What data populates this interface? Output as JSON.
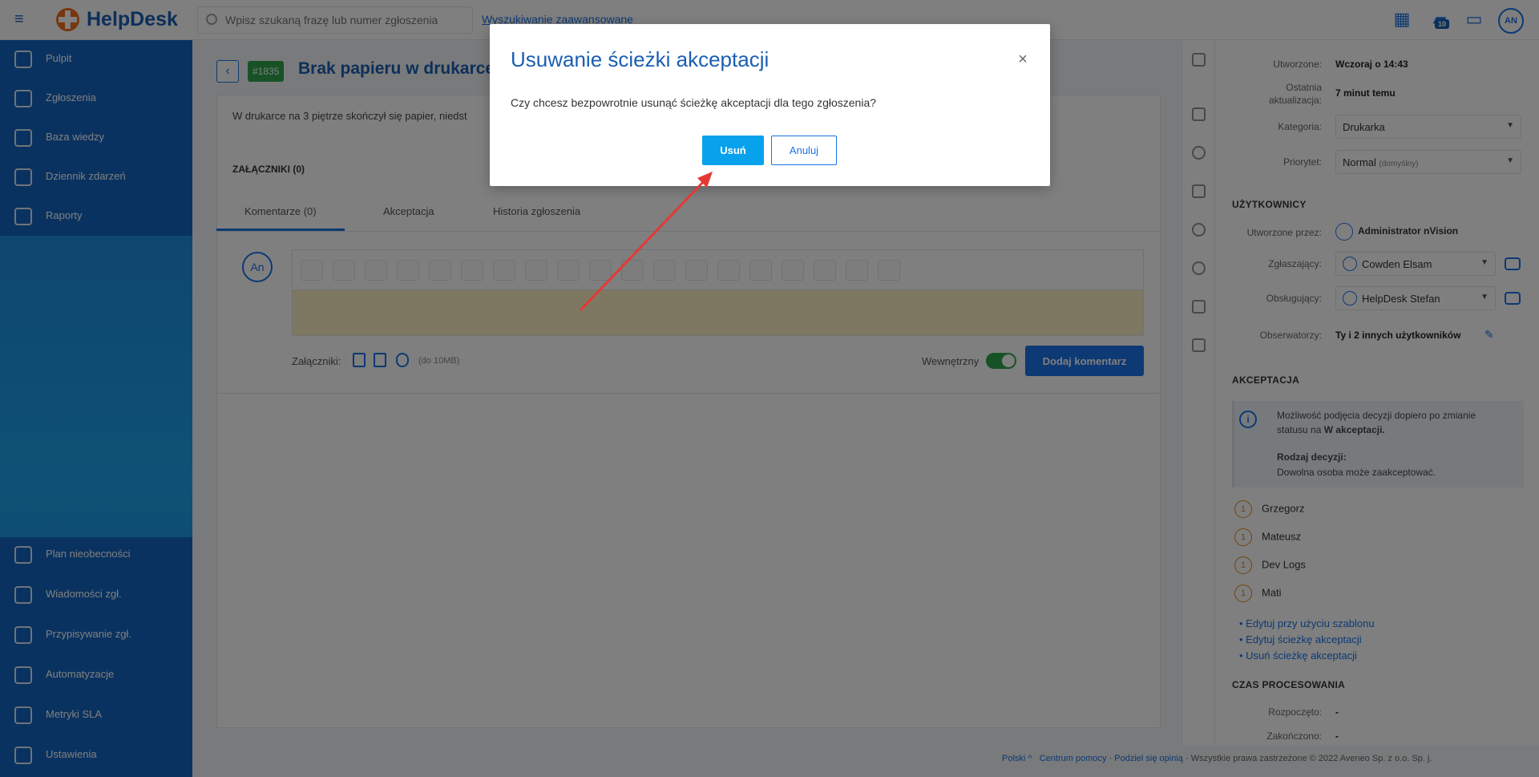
{
  "app": {
    "logo": "HelpDesk"
  },
  "topbar": {
    "search_placeholder": "Wpisz szukaną frazę lub numer zgłoszenia",
    "advanced_search": "Wyszukiwanie zaawansowane",
    "notif_count": "10",
    "user_initials": "AN"
  },
  "sidebar": {
    "items": [
      {
        "label": "Pulpit",
        "icon": "dashboard-icon"
      },
      {
        "label": "Zgłoszenia",
        "icon": "tickets-icon"
      },
      {
        "label": "Baza wiedzy",
        "icon": "knowledge-base-icon"
      },
      {
        "label": "Dziennik zdarzeń",
        "icon": "event-log-icon"
      },
      {
        "label": "Raporty",
        "icon": "reports-icon"
      }
    ],
    "bottom_items": [
      {
        "label": "Plan nieobecności",
        "icon": "absence-plan-icon"
      },
      {
        "label": "Wiadomości zgł.",
        "icon": "messages-icon"
      },
      {
        "label": "Przypisywanie zgł.",
        "icon": "assign-icon"
      },
      {
        "label": "Automatyzacje",
        "icon": "automation-icon"
      },
      {
        "label": "Metryki SLA",
        "icon": "sla-icon"
      },
      {
        "label": "Ustawienia",
        "icon": "settings-icon"
      }
    ]
  },
  "ticket": {
    "id": "#1835",
    "title": "Brak papieru w drukarce",
    "description": "W drukarce na 3 piętrze skończył się papier, niedst",
    "attachments_header": "ZAŁĄCZNIKI (0)",
    "tabs": [
      "Komentarze (0)",
      "Akceptacja",
      "Historia zgłoszenia"
    ],
    "comment_avatar": "An",
    "attachments_label": "Załączniki:",
    "attachments_size": "(do 10MB)",
    "internal_label": "Wewnętrzny",
    "add_comment": "Dodaj komentarz"
  },
  "details": {
    "created_label": "Utworzone:",
    "created_value": "Wczoraj o 14:43",
    "updated_label": "Ostatnia aktualizacja:",
    "updated_value": "7 minut temu",
    "category_label": "Kategoria:",
    "category_value": "Drukarka",
    "priority_label": "Priorytet:",
    "priority_value": "Normal",
    "priority_hint": "(domyślny)",
    "users_header": "UŻYTKOWNICY",
    "created_by_label": "Utworzone przez:",
    "created_by_value": "Administrator nVision",
    "requester_label": "Zgłaszający:",
    "requester_value": "Cowden Elsam",
    "handler_label": "Obsługujący:",
    "handler_value": "HelpDesk Stefan",
    "observers_label": "Obserwatorzy:",
    "observers_value": "Ty i 2 innych użytkowników",
    "approval_header": "AKCEPTACJA",
    "info_line1": "Możliwość podjęcia decyzji dopiero po zmianie",
    "info_line2_pre": "statusu na ",
    "info_line2_bold": "W akceptacji.",
    "decision_label": "Rodzaj decyzji:",
    "decision_value": "Dowolna osoba może zaakceptować.",
    "approvers": [
      {
        "num": "1",
        "name": "Grzegorz"
      },
      {
        "num": "1",
        "name": "Mateusz"
      },
      {
        "num": "1",
        "name": "Dev Logs"
      },
      {
        "num": "1",
        "name": "Mati"
      }
    ],
    "links": [
      "• Edytuj przy użyciu szablonu",
      "• Edytuj ścieżkę akceptacji",
      "• Usuń ścieżkę akceptacji"
    ],
    "processing_header": "CZAS PROCESOWANIA",
    "started_label": "Rozpoczęto:",
    "started_value": "-",
    "closed_label": "Zakończono:",
    "closed_value": "-"
  },
  "footer": {
    "lang": "Polski",
    "help": "Centrum pomocy",
    "share": "Podziel się opinią",
    "copyright": "Wszystkie prawa zastrzeżone © 2022 Aveneo Sp. z o.o. Sp. j."
  },
  "modal": {
    "title": "Usuwanie ścieżki akceptacji",
    "body": "Czy chcesz bezpowrotnie usunąć ścieżkę akceptacji dla tego zgłoszenia?",
    "confirm": "Usuń",
    "cancel": "Anuluj",
    "close_glyph": "×"
  },
  "colors": {
    "brand": "#1a5fb4",
    "accent": "#08a2ec",
    "annotation_arrow": "#e53935"
  }
}
